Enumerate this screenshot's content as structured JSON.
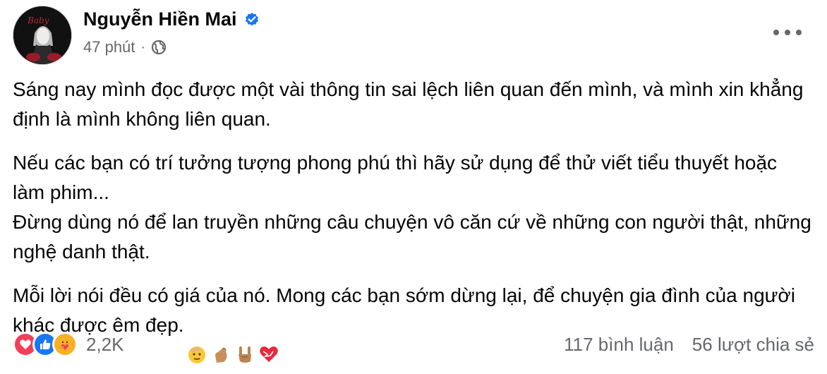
{
  "post": {
    "author": "Nguyễn Hiền Mai",
    "time": "47 phút",
    "separator": "·",
    "paragraphs": [
      "Sáng nay mình đọc được một vài thông tin sai lệch liên quan đến mình, và mình xin khẳng định là mình không liên quan.",
      "Nếu các bạn có trí tưởng tượng phong phú thì hãy sử dụng để thử viết tiểu thuyết hoặc làm phim...\nĐừng dùng nó để lan truyền những câu chuyện vô căn cứ về những con người thật, những nghệ danh thật.",
      "Mỗi lời nói đều có giá của nó. Mong các bạn sớm dừng lại, để chuyện gia đình của người khác được êm đẹp."
    ],
    "emojis": [
      "salute-face-icon",
      "pinch-hand-icon",
      "rock-on-hand-icon",
      "heart-icon"
    ]
  },
  "footer": {
    "reactions": [
      "love-reaction-icon",
      "like-reaction-icon",
      "care-reaction-icon"
    ],
    "reaction_count": "2,2K",
    "comments": "117 bình luận",
    "shares": "56 lượt chia sẻ"
  },
  "colors": {
    "verified": "#1877f2",
    "love": "#f33e58",
    "like": "#1877f2",
    "care": "#f7b125",
    "secondary_text": "#65676b"
  }
}
